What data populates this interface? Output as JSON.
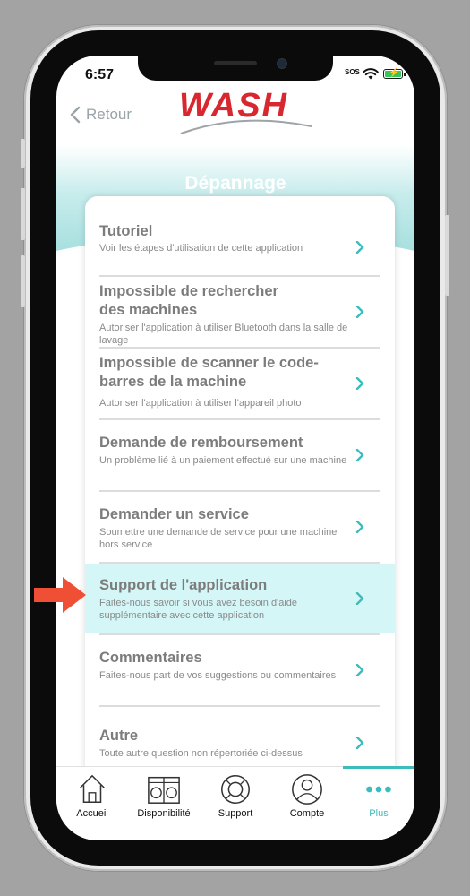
{
  "status_bar": {
    "time": "6:57",
    "sos": "SOS"
  },
  "header": {
    "back_label": "Retour",
    "logo_text": "WASH",
    "page_title": "Dépannage"
  },
  "menu": [
    {
      "title": "Tutoriel",
      "description": "Voir les étapes d'utilisation de cette application"
    },
    {
      "title": "Impossible de rechercher des machines",
      "description": "Autoriser l'application à utiliser Bluetooth dans la salle de lavage"
    },
    {
      "title": "Impossible de scanner le code-barres de la machine",
      "description": "Autoriser l'application à utiliser l'appareil photo"
    },
    {
      "title": "Demande de remboursement",
      "description": "Un problème lié à un paiement effectué sur une machine"
    },
    {
      "title": "Demander un service",
      "description": "Soumettre une demande de service pour une machine hors service"
    },
    {
      "title": "Support de l'application",
      "description": "Faites-nous savoir si vous avez besoin d'aide supplémentaire avec cette application",
      "highlighted": true
    },
    {
      "title": "Commentaires",
      "description": "Faites-nous part de vos suggestions ou commentaires"
    },
    {
      "title": "Autre",
      "description": "Toute autre question non répertoriée ci-dessus"
    }
  ],
  "tabs": [
    {
      "label": "Accueil",
      "icon": "home-icon"
    },
    {
      "label": "Disponibilité",
      "icon": "washer-dryer-icon"
    },
    {
      "label": "Support",
      "icon": "lifebuoy-icon"
    },
    {
      "label": "Compte",
      "icon": "person-icon"
    },
    {
      "label": "Plus",
      "icon": "more-dots-icon",
      "active": true
    }
  ],
  "colors": {
    "accent": "#3dbcbc",
    "brand_red": "#d8272f",
    "highlight": "#d4f6f7",
    "pointer_arrow": "#ef4f35"
  }
}
